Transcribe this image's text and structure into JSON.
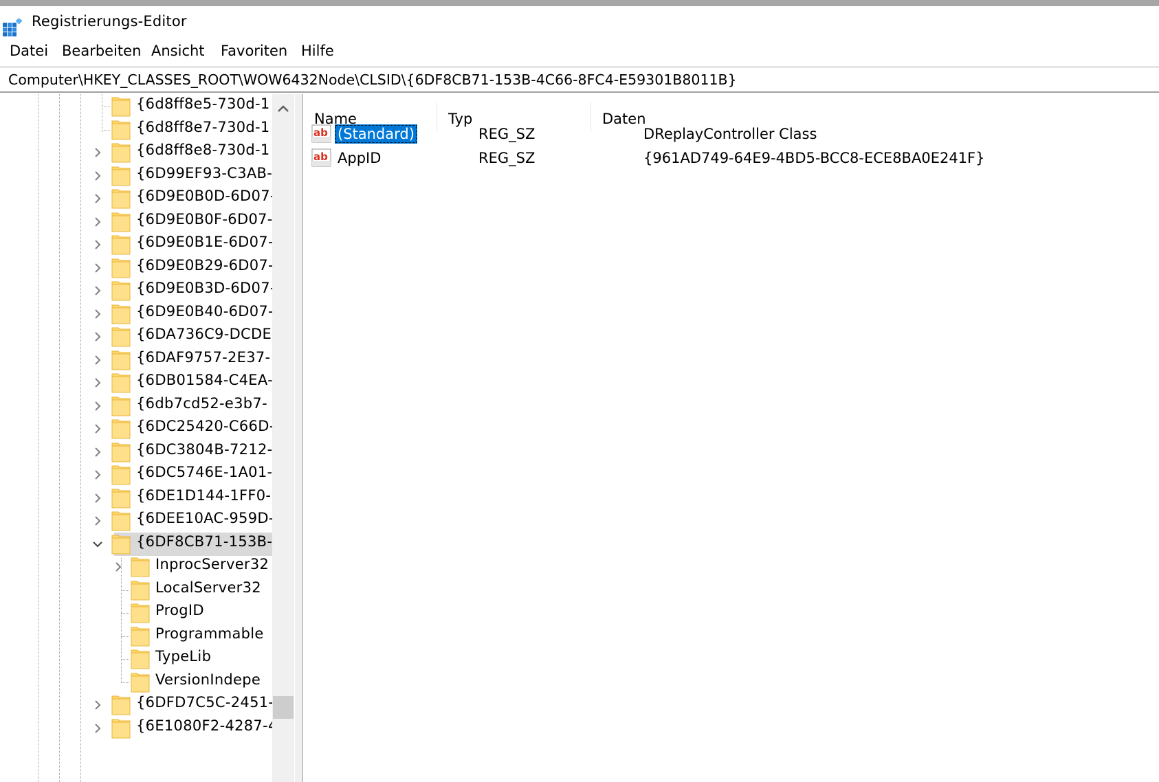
{
  "window": {
    "title": "Registrierungs-Editor"
  },
  "menu": {
    "items": [
      "Datei",
      "Bearbeiten",
      "Ansicht",
      "Favoriten",
      "Hilfe"
    ]
  },
  "address": {
    "path": "Computer\\HKEY_CLASSES_ROOT\\WOW6432Node\\CLSID\\{6DF8CB71-153B-4C66-8FC4-E59301B8011B}"
  },
  "tree": {
    "items": [
      {
        "label": "{6d8ff8e5-730d-1",
        "expander": "none",
        "level": 0
      },
      {
        "label": "{6d8ff8e7-730d-1",
        "expander": "none",
        "level": 0
      },
      {
        "label": "{6d8ff8e8-730d-1",
        "expander": "collapsed",
        "level": 0
      },
      {
        "label": "{6D99EF93-C3AB-",
        "expander": "collapsed",
        "level": 0
      },
      {
        "label": "{6D9E0B0D-6D07-",
        "expander": "collapsed",
        "level": 0
      },
      {
        "label": "{6D9E0B0F-6D07-",
        "expander": "collapsed",
        "level": 0
      },
      {
        "label": "{6D9E0B1E-6D07-",
        "expander": "collapsed",
        "level": 0
      },
      {
        "label": "{6D9E0B29-6D07-",
        "expander": "collapsed",
        "level": 0
      },
      {
        "label": "{6D9E0B3D-6D07-",
        "expander": "collapsed",
        "level": 0
      },
      {
        "label": "{6D9E0B40-6D07-",
        "expander": "collapsed",
        "level": 0
      },
      {
        "label": "{6DA736C9-DCDE",
        "expander": "collapsed",
        "level": 0
      },
      {
        "label": "{6DAF9757-2E37-",
        "expander": "collapsed",
        "level": 0
      },
      {
        "label": "{6DB01584-C4EA-",
        "expander": "collapsed",
        "level": 0
      },
      {
        "label": "{6db7cd52-e3b7-",
        "expander": "collapsed",
        "level": 0
      },
      {
        "label": "{6DC25420-C66D-",
        "expander": "collapsed",
        "level": 0
      },
      {
        "label": "{6DC3804B-7212-",
        "expander": "collapsed",
        "level": 0
      },
      {
        "label": "{6DC5746E-1A01-",
        "expander": "collapsed",
        "level": 0
      },
      {
        "label": "{6DE1D144-1FF0-",
        "expander": "collapsed",
        "level": 0
      },
      {
        "label": "{6DEE10AC-959D-",
        "expander": "collapsed",
        "level": 0
      },
      {
        "label": "{6DF8CB71-153B-",
        "expander": "expanded",
        "level": 0,
        "selected": true
      },
      {
        "label": "InprocServer32",
        "expander": "collapsed",
        "level": 1
      },
      {
        "label": "LocalServer32",
        "expander": "none",
        "level": 1
      },
      {
        "label": "ProgID",
        "expander": "none",
        "level": 1
      },
      {
        "label": "Programmable",
        "expander": "none",
        "level": 1
      },
      {
        "label": "TypeLib",
        "expander": "none",
        "level": 1
      },
      {
        "label": "VersionIndepe",
        "expander": "none",
        "level": 1
      },
      {
        "label": "{6DFD7C5C-2451-",
        "expander": "collapsed",
        "level": 0
      },
      {
        "label": "{6E1080F2-4287-4",
        "expander": "collapsed",
        "level": 0
      }
    ]
  },
  "list": {
    "headers": [
      "Name",
      "Typ",
      "Daten"
    ],
    "rows": [
      {
        "name": "(Standard)",
        "type": "REG_SZ",
        "data": "DReplayController Class",
        "selected": true,
        "icon": "reg-sz-icon"
      },
      {
        "name": "AppID",
        "type": "REG_SZ",
        "data": "{961AD749-64E9-4BD5-BCC8-ECE8BA0E241F}",
        "selected": false,
        "icon": "reg-sz-icon"
      }
    ]
  },
  "colors": {
    "selection": "#0078d7",
    "folder": "#ffd86b",
    "treeSelection": "#d9d9d9"
  }
}
